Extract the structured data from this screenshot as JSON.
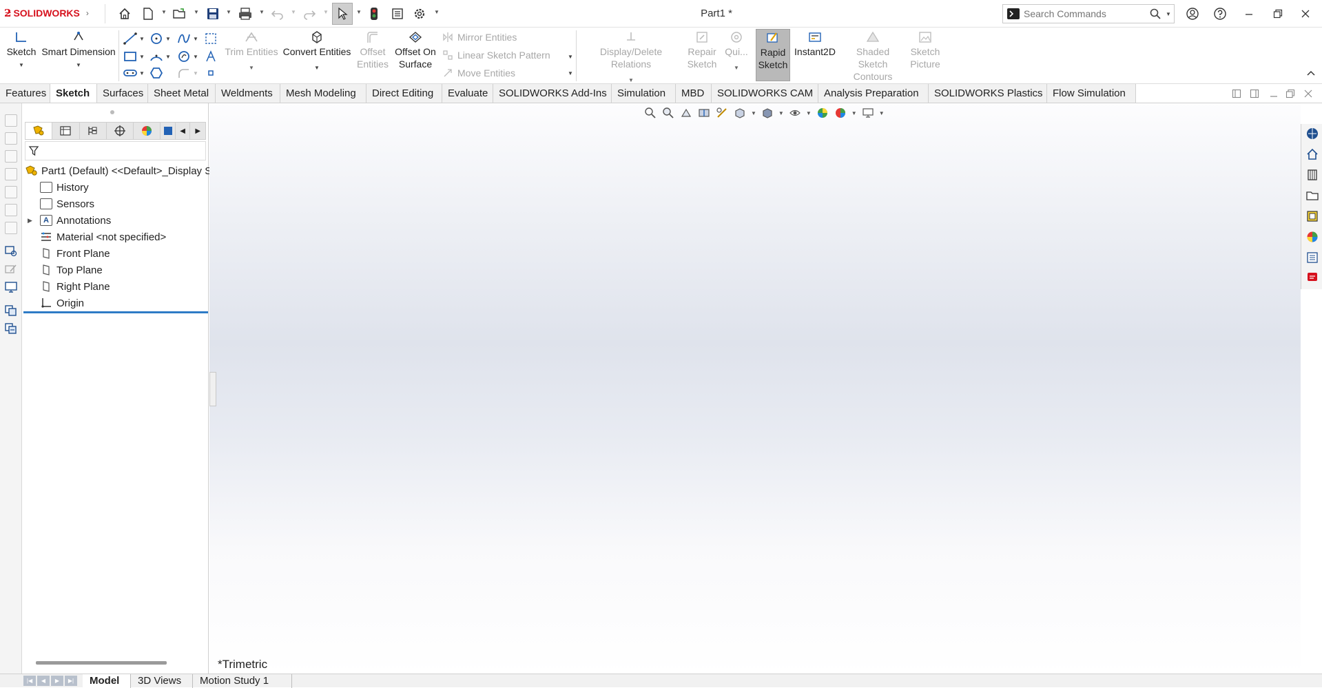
{
  "titlebar": {
    "logo_mark": "ƻ",
    "logo_text": "SOLIDWORKS",
    "document_title": "Part1 *",
    "search_placeholder": "Search Commands"
  },
  "commands": {
    "sketch": "Sketch",
    "smart_dimension": "Smart Dimension",
    "trim_entities": "Trim Entities",
    "convert_entities": "Convert Entities",
    "offset_entities_1": "Offset",
    "offset_entities_2": "Entities",
    "offset_on_surface_1": "Offset On",
    "offset_on_surface_2": "Surface",
    "mirror_entities": "Mirror Entities",
    "linear_sketch_pattern": "Linear Sketch Pattern",
    "move_entities": "Move Entities",
    "display_delete_relations": "Display/Delete Relations",
    "repair_sketch_1": "Repair",
    "repair_sketch_2": "Sketch",
    "quick_snaps": "Qui...",
    "rapid_sketch_1": "Rapid",
    "rapid_sketch_2": "Sketch",
    "instant2d": "Instant2D",
    "shaded_sketch_contours_1": "Shaded Sketch",
    "shaded_sketch_contours_2": "Contours",
    "sketch_picture_1": "Sketch",
    "sketch_picture_2": "Picture"
  },
  "tabs": [
    {
      "label": "Features"
    },
    {
      "label": "Sketch"
    },
    {
      "label": "Surfaces"
    },
    {
      "label": "Sheet Metal"
    },
    {
      "label": "Weldments"
    },
    {
      "label": "Mesh Modeling"
    },
    {
      "label": "Direct Editing"
    },
    {
      "label": "Evaluate"
    },
    {
      "label": "SOLIDWORKS Add-Ins"
    },
    {
      "label": "Simulation"
    },
    {
      "label": "MBD"
    },
    {
      "label": "SOLIDWORKS CAM"
    },
    {
      "label": "Analysis Preparation"
    },
    {
      "label": "SOLIDWORKS Plastics"
    },
    {
      "label": "Flow Simulation"
    }
  ],
  "active_tab": "Sketch",
  "feature_tree": {
    "root": "Part1 (Default) <<Default>_Display S",
    "items": [
      {
        "label": "History",
        "icon": "history-icon"
      },
      {
        "label": "Sensors",
        "icon": "sensors-icon"
      },
      {
        "label": "Annotations",
        "icon": "annotations-icon"
      },
      {
        "label": "Material <not specified>",
        "icon": "material-icon"
      },
      {
        "label": "Front Plane",
        "icon": "plane-icon"
      },
      {
        "label": "Top Plane",
        "icon": "plane-icon"
      },
      {
        "label": "Right Plane",
        "icon": "plane-icon"
      },
      {
        "label": "Origin",
        "icon": "origin-icon"
      }
    ]
  },
  "viewport": {
    "view_orientation": "*Trimetric"
  },
  "bottom_tabs": [
    {
      "label": "Model"
    },
    {
      "label": "3D Views"
    },
    {
      "label": "Motion Study 1"
    }
  ],
  "colors": {
    "brand": "#d6111d",
    "accent_blue": "#2e7bc6",
    "rapid_sketch_active": "#b9b9b9"
  }
}
